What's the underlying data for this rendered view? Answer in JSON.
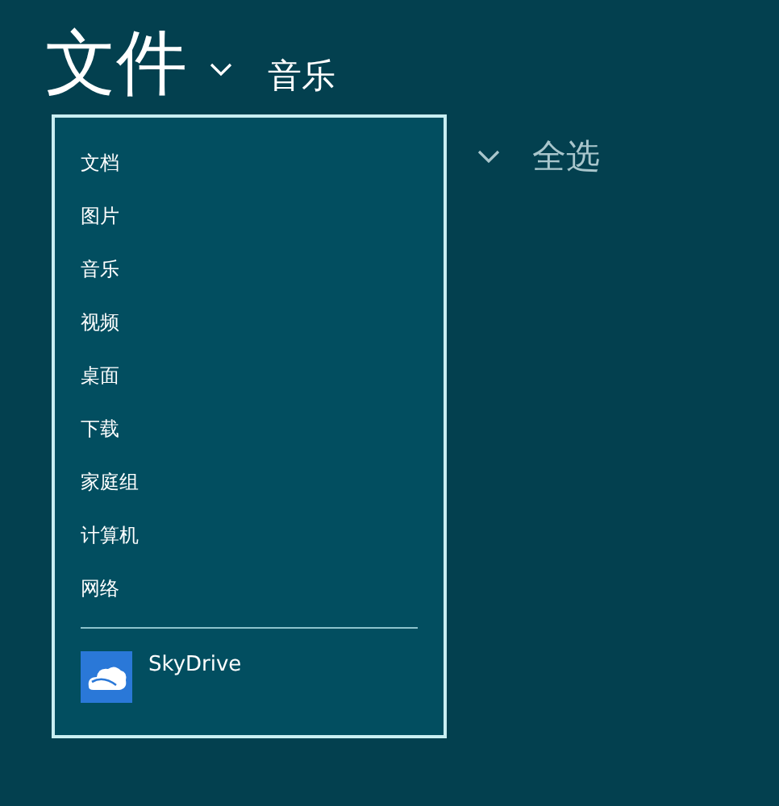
{
  "header": {
    "title": "文件",
    "location": "音乐"
  },
  "toolbar": {
    "select_all": "全选"
  },
  "menu": {
    "items": [
      {
        "label": "文档",
        "kind": "folder"
      },
      {
        "label": "图片",
        "kind": "folder"
      },
      {
        "label": "音乐",
        "kind": "folder"
      },
      {
        "label": "视频",
        "kind": "folder"
      },
      {
        "label": "桌面",
        "kind": "folder"
      },
      {
        "label": "下载",
        "kind": "folder"
      },
      {
        "label": "家庭组",
        "kind": "folder"
      },
      {
        "label": "计算机",
        "kind": "folder"
      },
      {
        "label": "网络",
        "kind": "folder"
      },
      {
        "label": "SkyDrive",
        "kind": "service"
      }
    ]
  }
}
